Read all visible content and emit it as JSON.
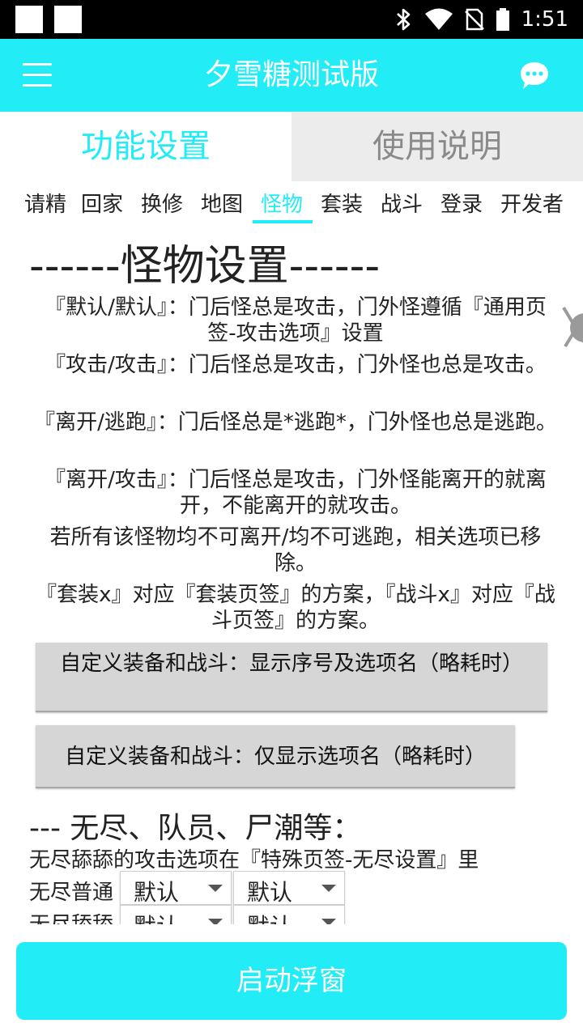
{
  "status_bar": {
    "time": "1:51",
    "icons": [
      "bluetooth-icon",
      "wifi-icon",
      "no-sim-icon",
      "battery-icon"
    ]
  },
  "app_bar": {
    "title": "夕雪糖测试版",
    "menu_icon": "menu-icon",
    "chat_icon": "chat-icon"
  },
  "main_tabs": [
    {
      "label": "功能设置",
      "active": true
    },
    {
      "label": "使用说明",
      "active": false
    }
  ],
  "sub_tabs": [
    {
      "label": "请精"
    },
    {
      "label": "回家"
    },
    {
      "label": "换修"
    },
    {
      "label": "地图"
    },
    {
      "label": "怪物",
      "active": true
    },
    {
      "label": "套装"
    },
    {
      "label": "战斗"
    },
    {
      "label": "登录"
    },
    {
      "label": "开发者"
    }
  ],
  "content": {
    "section_title": "------怪物设置------",
    "descriptions": [
      "『默认/默认』：门后怪总是攻击，门外怪遵循『通用页签-攻击选项』设置",
      "『攻击/攻击』：门后怪总是攻击，门外怪也总是攻击。",
      "『离开/逃跑』：门后怪总是*逃跑*，门外怪也总是逃跑。",
      "『离开/攻击』：门后怪总是攻击，门外怪能离开的就离开，不能离开的就攻击。",
      "若所有该怪物均不可离开/均不可逃跑，相关选项已移除。",
      "『套装x』对应『套装页签』的方案，『战斗x』对应『战斗页签』的方案。"
    ],
    "button_1": "自定义装备和战斗：显示序号及选项名（略耗时）",
    "button_2": "自定义装备和战斗：仅显示选项名（略耗时）",
    "subheading": "--- 无尽、队员、尸潮等：",
    "note": "无尽舔舔的攻击选项在『特殊页签-无尽设置』里",
    "rows": [
      {
        "label": "无尽普通",
        "select_1": "默认",
        "select_2": "默认"
      },
      {
        "label": "无尽舔舔",
        "select_1": "默认",
        "select_2": "默认"
      }
    ]
  },
  "bottom_button": "启动浮窗",
  "colors": {
    "accent": "#22ecf6",
    "inactive_tab_bg": "#ececec",
    "button_bg": "#d6d6d6"
  }
}
